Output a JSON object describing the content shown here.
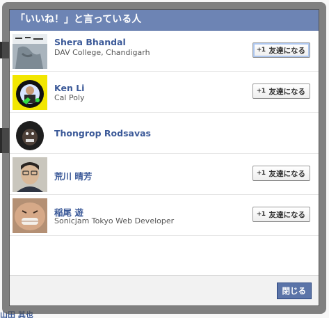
{
  "dialog": {
    "title": "「いいね！」と言っている人",
    "close_label": "閉じる"
  },
  "people": [
    {
      "name": "Shera Bhandal",
      "subtitle": "DAV College, Chandigarh",
      "button_label": "友達になる",
      "has_button": true
    },
    {
      "name": "Ken Li",
      "subtitle": "Cal Poly",
      "button_label": "友達になる",
      "has_button": true
    },
    {
      "name": "Thongrop Rodsavas",
      "subtitle": "",
      "button_label": "",
      "has_button": false
    },
    {
      "name": "荒川 晴芳",
      "subtitle": "",
      "button_label": "友達になる",
      "has_button": true
    },
    {
      "name": "稲尾 遊",
      "subtitle": "Sonicjam Tokyo Web Developer",
      "button_label": "友達になる",
      "has_button": true
    }
  ],
  "background": {
    "partial_link": "山田 其也"
  },
  "colors": {
    "header_bg": "#6d84b4",
    "link": "#3b5998",
    "close_button_bg": "#5b74a8"
  }
}
